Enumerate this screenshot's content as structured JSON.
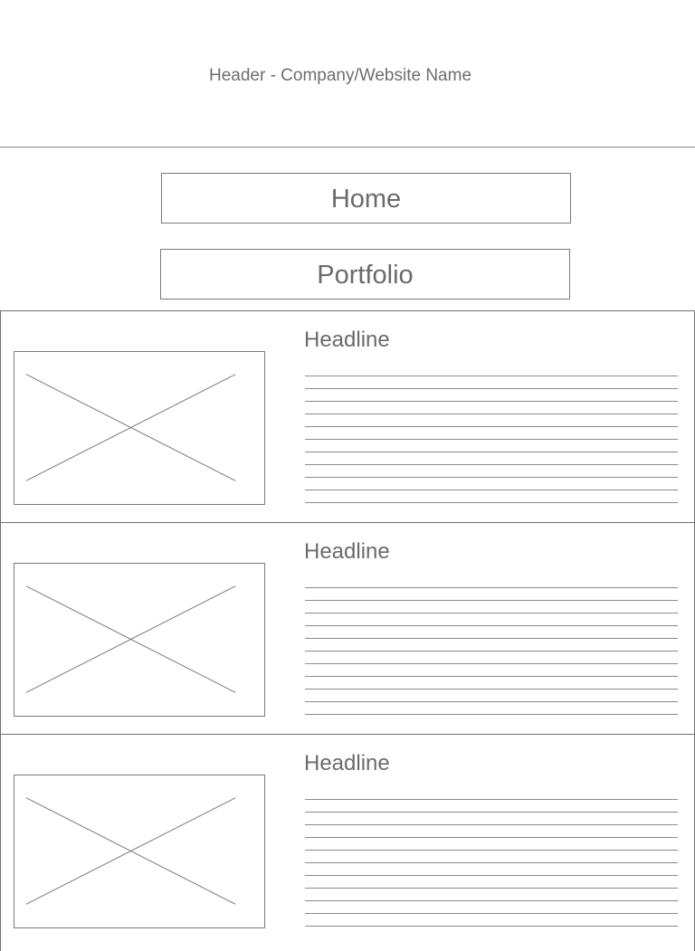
{
  "header": {
    "title": "Header - Company/Website Name"
  },
  "nav": {
    "home_label": "Home",
    "portfolio_label": "Portfolio"
  },
  "cards": [
    {
      "headline": "Headline",
      "image_icon": "image-placeholder-icon",
      "text_line_count": 11
    },
    {
      "headline": "Headline",
      "image_icon": "image-placeholder-icon",
      "text_line_count": 11
    },
    {
      "headline": "Headline",
      "image_icon": "image-placeholder-icon",
      "text_line_count": 11
    }
  ],
  "colors": {
    "border": "#7a7a7a",
    "text": "#6b6b6b",
    "background": "#ffffff"
  }
}
